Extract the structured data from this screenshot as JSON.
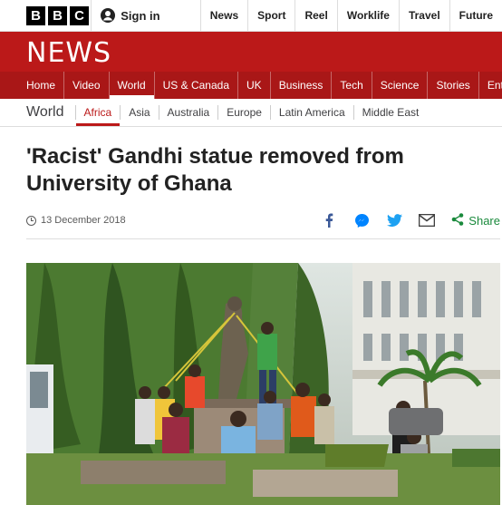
{
  "brand": {
    "letters": [
      "B",
      "B",
      "C"
    ],
    "section_title": "NEWS"
  },
  "account": {
    "signin_label": "Sign in",
    "icon": "user-icon"
  },
  "top_nav": [
    "News",
    "Sport",
    "Reel",
    "Worklife",
    "Travel",
    "Future"
  ],
  "main_nav": {
    "items": [
      "Home",
      "Video",
      "World",
      "US & Canada",
      "UK",
      "Business",
      "Tech",
      "Science",
      "Stories",
      "Ente"
    ],
    "active": "World"
  },
  "sub_nav": {
    "section": "World",
    "items": [
      "Africa",
      "Asia",
      "Australia",
      "Europe",
      "Latin America",
      "Middle East"
    ],
    "active": "Africa"
  },
  "article": {
    "headline": "'Racist' Gandhi statue removed from University of Ghana",
    "date": "13 December 2018"
  },
  "share": {
    "icons": [
      "facebook-icon",
      "messenger-icon",
      "twitter-icon",
      "email-icon"
    ],
    "label": "Share",
    "colors": {
      "facebook": "#3b5998",
      "messenger": "#0084ff",
      "twitter": "#1da1f2",
      "email": "#404040",
      "share": "#1a8a3c"
    }
  },
  "colors": {
    "news_band": "#bb1919",
    "nav_band": "#a91717"
  }
}
